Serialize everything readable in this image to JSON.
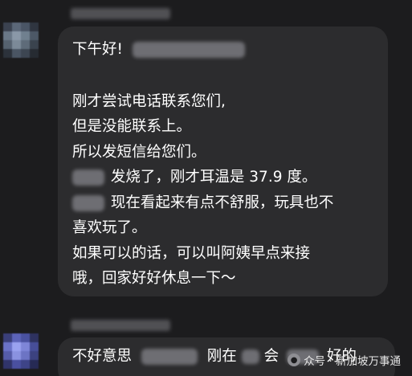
{
  "message_1": {
    "line_1_prefix": "下午好!",
    "line_2": "刚才尝试电话联系您们,",
    "line_3": "但是没能联系上。",
    "line_4": "所以发短信给您们。",
    "line_5_suffix": "发烧了，刚才耳温是 37.9 度。",
    "line_6_suffix": "现在看起来有点不舒服，玩具也不",
    "line_7": "喜欢玩了。",
    "line_8": "如果可以的话，可以叫阿姨早点来接",
    "line_9": "哦，回家好好休息一下～"
  },
  "message_2": {
    "text_prefix": "不好意思",
    "text_middle": "刚在",
    "text_after": "会",
    "text_end": "好的"
  },
  "watermark": {
    "icon": "wechat-icon",
    "text": "众号 · 新加坡万事通"
  },
  "colors": {
    "background": "#1c1c1e",
    "bubble": "#2c2c2e",
    "text": "#ffffff"
  }
}
